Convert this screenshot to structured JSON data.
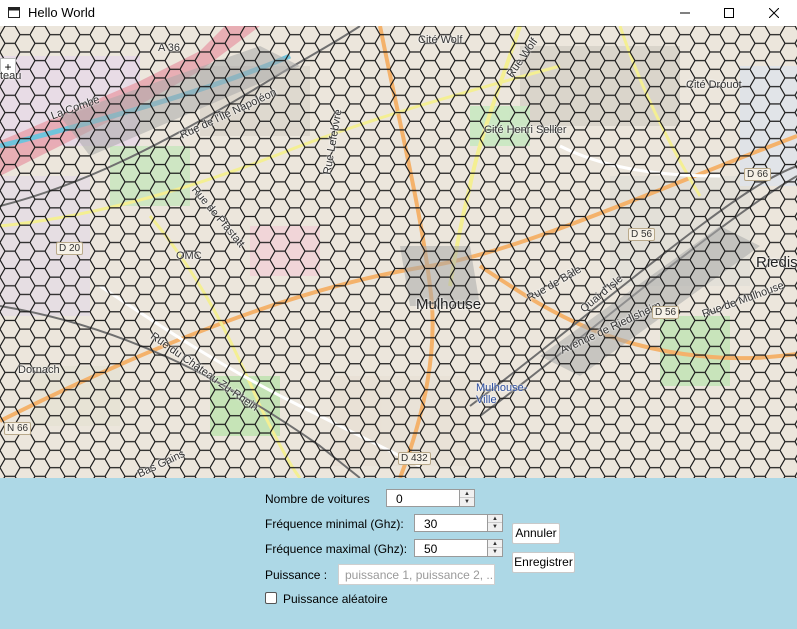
{
  "window": {
    "title": "Hello World",
    "controls": [
      "minimize-icon",
      "maximize-icon",
      "close-icon"
    ]
  },
  "map": {
    "zoom_in_label": "+",
    "labels": {
      "teau": "teau",
      "a36": "A 36",
      "lacombe": "La Combe",
      "cite_wolf": "Cité Wolf",
      "cite_drouot": "Cité Drouot",
      "cite_sellier": "Cité Henri Sellier",
      "rue_ile_napoleon": "Rue de l'Île Napoléon",
      "rue_wolf": "Rue Wolf",
      "rue_lefebvre": "Rue Lefebvre",
      "rue_pfastatt": "Rue de Pfastatt",
      "rue_de_bale": "Rue de Bâle",
      "quai_hanner": "Quai d'Isle",
      "ave_riedisheim": "Avenue de Riedisheim",
      "rue_mulhouse": "Rue de Mulhouse",
      "d66": "D 66",
      "d20": "D 20",
      "n66": "N 66",
      "d432": "D 432",
      "d56": "D 56",
      "riedis": "Riedis",
      "mulhouse": "Mulhouse",
      "mulhouse_ville": "Mulhouse-Ville",
      "dornach": "Dornach",
      "rue_du_chateau": "Rue du Château Zu-Rhein",
      "omc": "OMC",
      "bas_gains": "Bas Gains"
    }
  },
  "form": {
    "nb_voitures_label": "Nombre de voitures",
    "nb_voitures_value": "0",
    "freq_min_label": "Fréquence minimal (Ghz):",
    "freq_min_value": "30",
    "freq_max_label": "Fréquence maximal (Ghz):",
    "freq_max_value": "50",
    "puissance_label": "Puissance :",
    "puissance_placeholder": "puissance 1, puissance 2, ...",
    "puissance_random_label": "Puissance aléatoire",
    "puissance_random_checked": false,
    "cancel_label": "Annuler",
    "save_label": "Enregistrer"
  },
  "colors": {
    "panel_bg": "#add8e6",
    "hex_stroke": "#1a1a1a",
    "map_bg": "#ece6dc",
    "road_orange": "#f4b26b",
    "road_yellow": "#f4ef93",
    "rail_gray": "#777777",
    "green_area": "#b9e3b0"
  }
}
